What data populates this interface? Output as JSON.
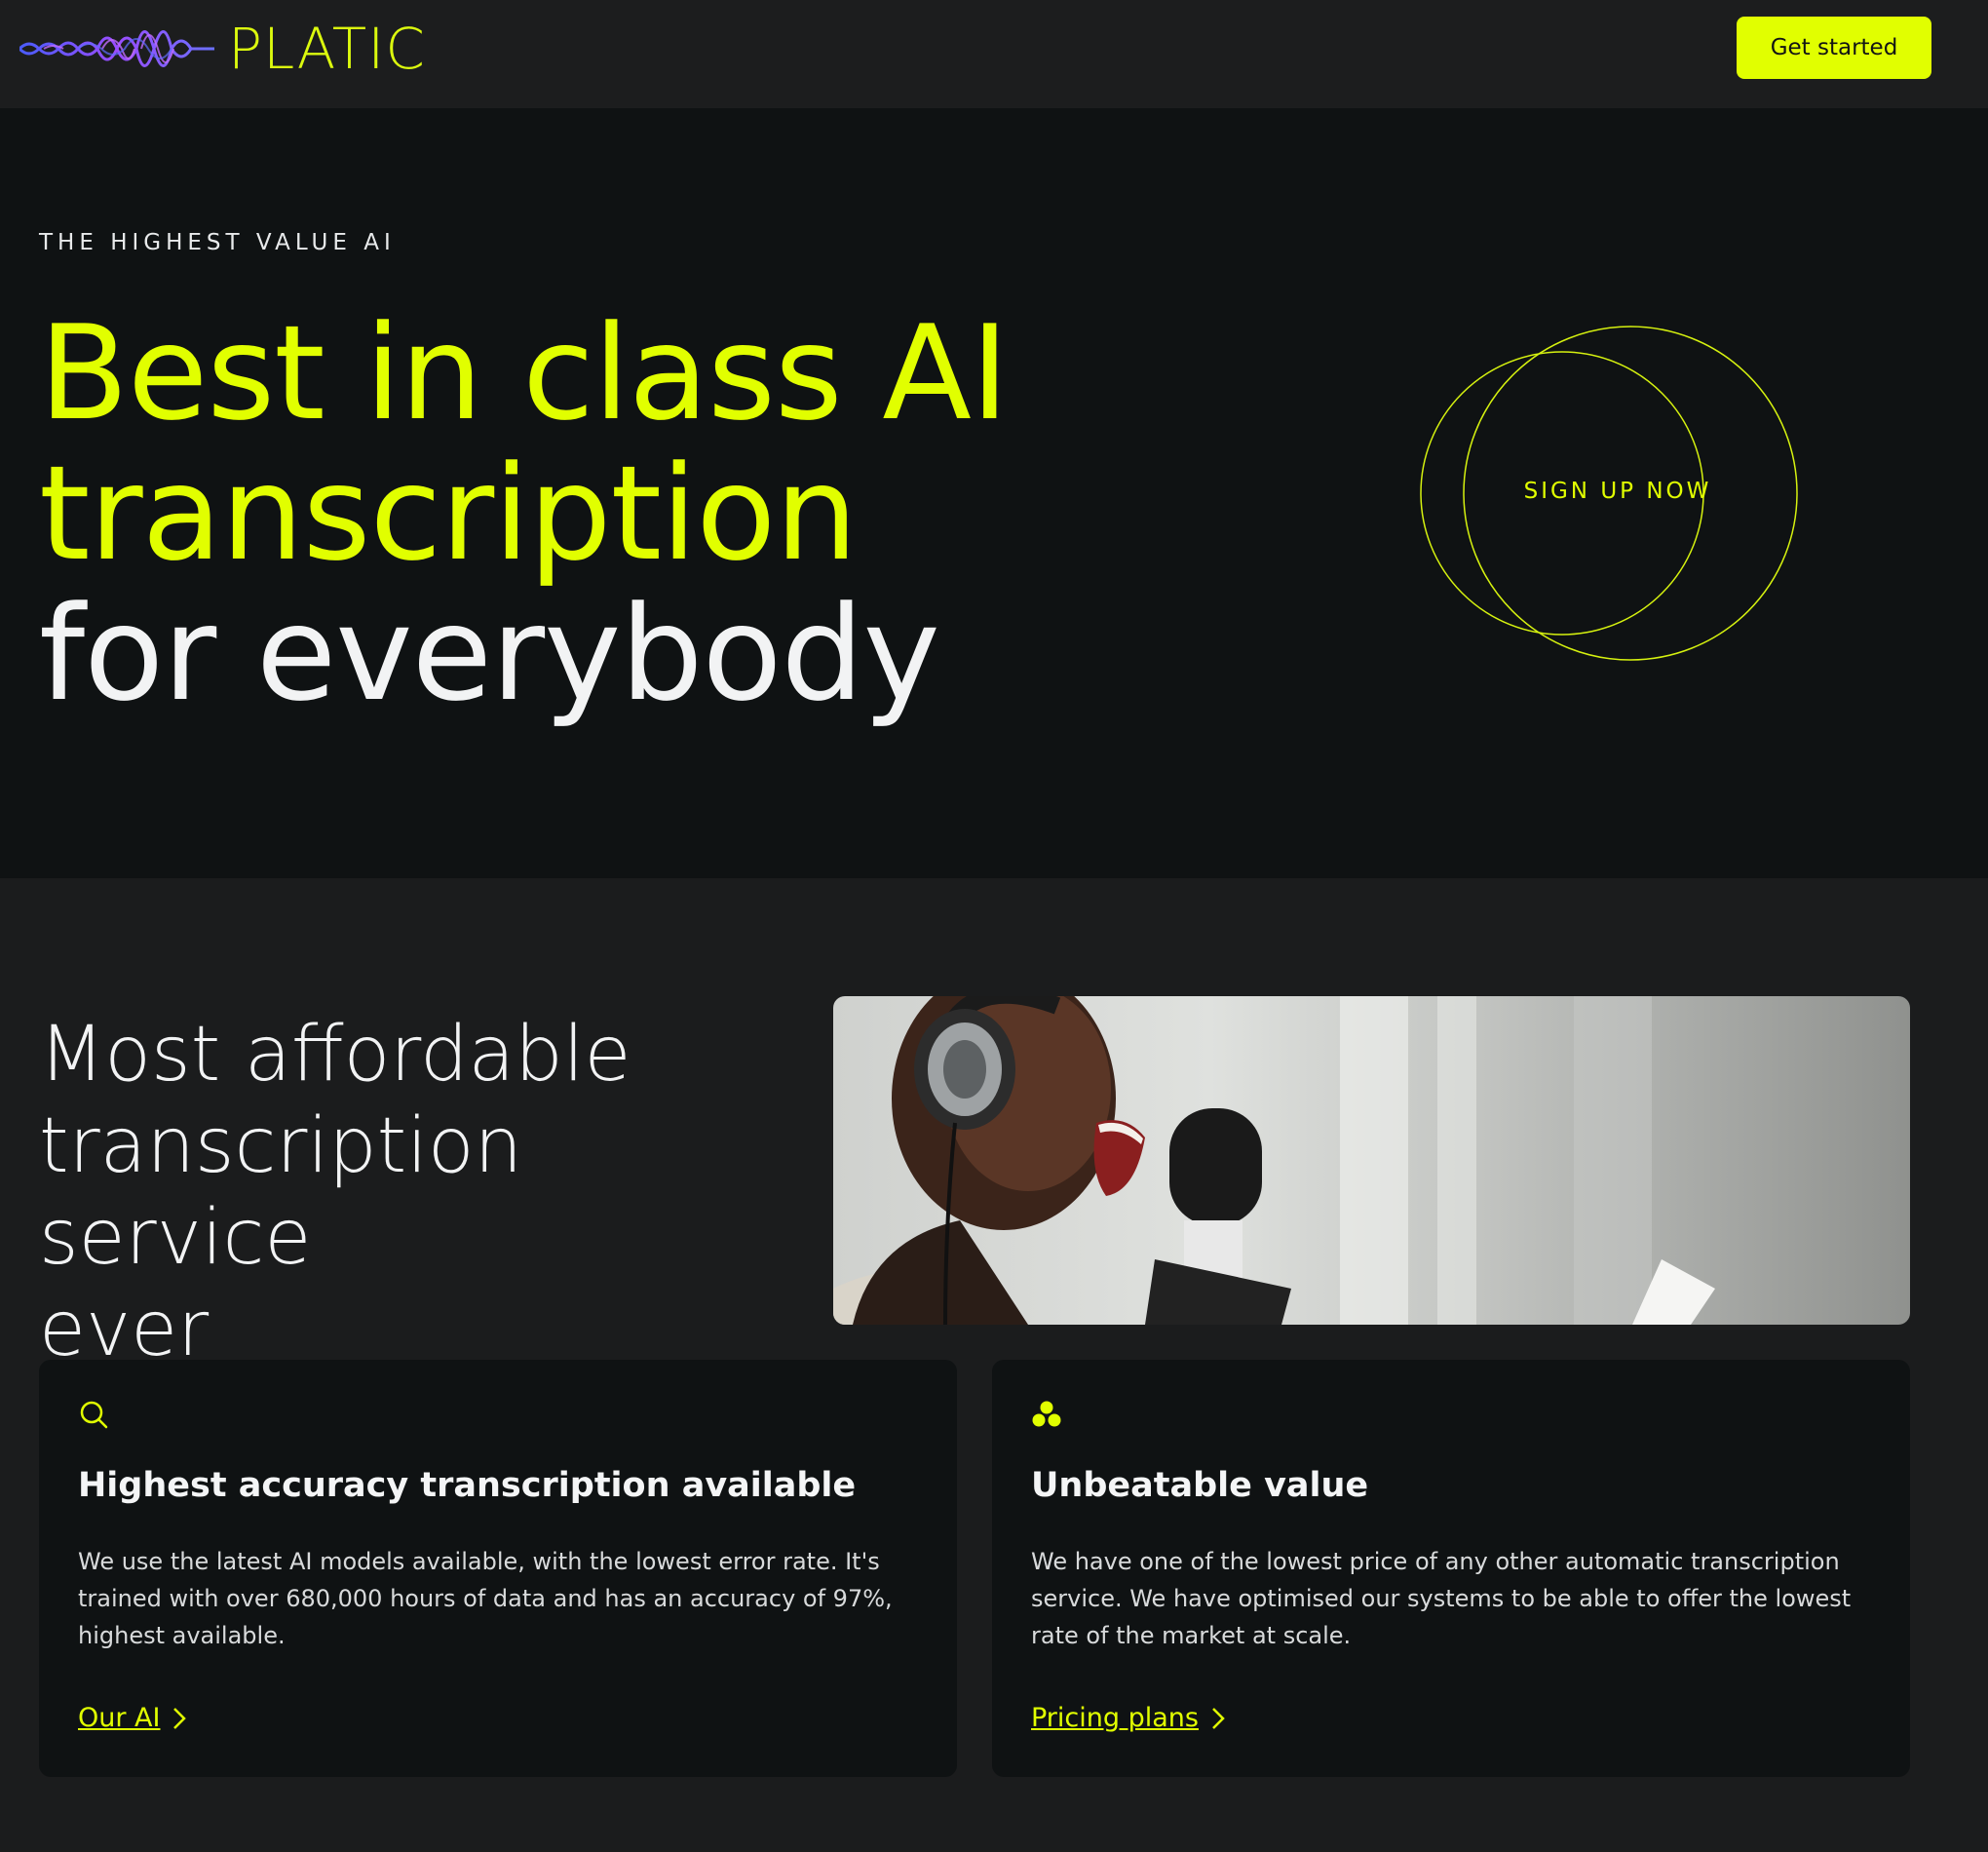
{
  "header": {
    "brand": "PLATIC",
    "cta_label": "Get started",
    "logo_icon": "sound-wave-icon"
  },
  "hero": {
    "eyebrow": "THE HIGHEST VALUE AI",
    "headline_line1": "Best in class AI",
    "headline_line2": "transcription",
    "headline_line3": "for everybody",
    "signup_label": "SIGN UP NOW"
  },
  "affordable": {
    "title_line1": "Most affordable",
    "title_line2": "transcription service",
    "title_line3": "ever"
  },
  "cards": [
    {
      "icon": "search-icon",
      "title": "Highest accuracy transcription available",
      "body": "We use the latest AI models available, with the lowest error rate. It's trained with over 680,000 hours of data and has an accuracy of 97%, highest available.",
      "link_label": "Our AI"
    },
    {
      "icon": "three-dots-icon",
      "title": "Unbeatable value",
      "body": "We have one of the lowest price of any other automatic transcription service. We have optimised our systems to be able to offer the lowest rate of the market at scale.",
      "link_label": "Pricing plans"
    }
  ],
  "colors": {
    "accent": "#e1ff00",
    "background_dark": "#0f1213",
    "background_mid": "#1b1c1d",
    "text": "#f2f3f4"
  }
}
